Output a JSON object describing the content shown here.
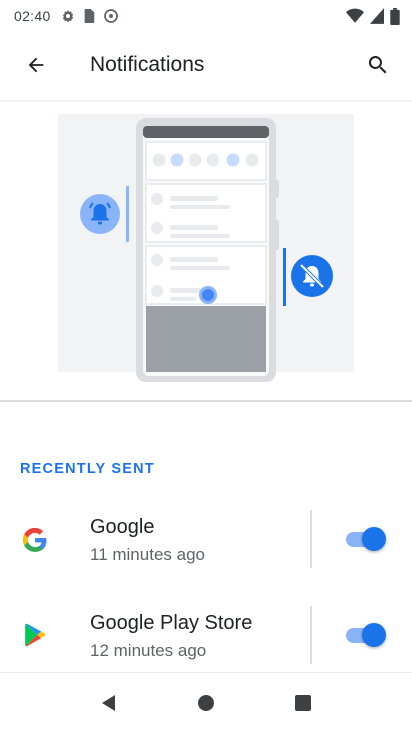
{
  "status_bar": {
    "time": "02:40",
    "left_icons": [
      "settings-gear-icon",
      "sim-card-icon",
      "circle-notification-icon"
    ],
    "right_icons": [
      "wifi-icon",
      "cell-signal-icon",
      "battery-icon"
    ]
  },
  "app_bar": {
    "title": "Notifications",
    "back_icon": "arrow-back-icon",
    "search_icon": "search-icon"
  },
  "section": {
    "header": "RECENTLY SENT"
  },
  "apps": [
    {
      "name": "Google",
      "time": "11 minutes ago",
      "icon": "google-g-icon",
      "enabled": true
    },
    {
      "name": "Google Play Store",
      "time": "12 minutes ago",
      "icon": "play-store-icon",
      "enabled": true
    }
  ],
  "colors": {
    "accent": "#1a73e8",
    "accent_light": "#8ab4f8",
    "illustration_bg": "#f1f3f4",
    "phone_bezel": "#dadce0",
    "phone_screen": "#80868b"
  },
  "nav_bar": {
    "buttons": [
      "back-triangle-icon",
      "home-circle-icon",
      "recents-square-icon"
    ]
  }
}
